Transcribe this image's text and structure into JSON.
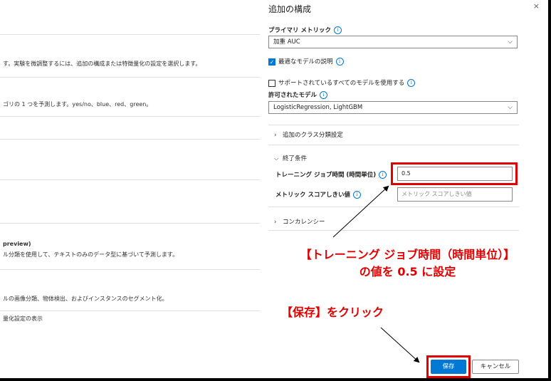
{
  "background_page": {
    "texts": [
      "す。実験を微調整するには、追加の構成または特徴量化の設定を選択します。",
      "ゴリの 1 つを予測します。yes/no、blue、red、green。",
      "preview)",
      "ル分類を使用して、テキストのみのデータ型に基づいて予測します。",
      "ルの画像分類、物体検出、およびインスタンスのセグメント化。",
      "量化設定の表示"
    ]
  },
  "panel": {
    "title": "追加の構成",
    "close_label": "×",
    "primary_metric_label": "プライマリ メトリック",
    "primary_metric_value": "加重 AUC",
    "explain_best_model_label": "最適なモデルの説明",
    "explain_best_model_checked": true,
    "use_all_models_label": "サポートされているすべてのモデルを使用する",
    "use_all_models_checked": false,
    "allowed_models_label": "許可されたモデル",
    "allowed_models_value": "LogisticRegression, LightGBM",
    "additional_classification_label": "追加のクラス分類設定",
    "exit_criteria_label": "終了条件",
    "training_job_time_label": "トレーニング ジョブ時間 (時間単位)",
    "training_job_time_value": "0.5",
    "metric_score_threshold_label": "メトリック スコアしきい値",
    "metric_score_threshold_placeholder": "メトリック スコアしきい値",
    "concurrency_label": "コンカレンシー",
    "save_label": "保存",
    "cancel_label": "キャンセル",
    "info_glyph": "i",
    "chevron_down": "⌵",
    "chevron_right": "›"
  },
  "annotations": {
    "instruction_line1": "【トレーニング ジョブ時間（時間単位）】",
    "instruction_line2": "の値を 0.5 に設定",
    "instruction_save": "【保存】をクリック",
    "highlight_color": "#e00000"
  },
  "colors": {
    "accent": "#0078d4",
    "annotation_red": "#e00000"
  }
}
